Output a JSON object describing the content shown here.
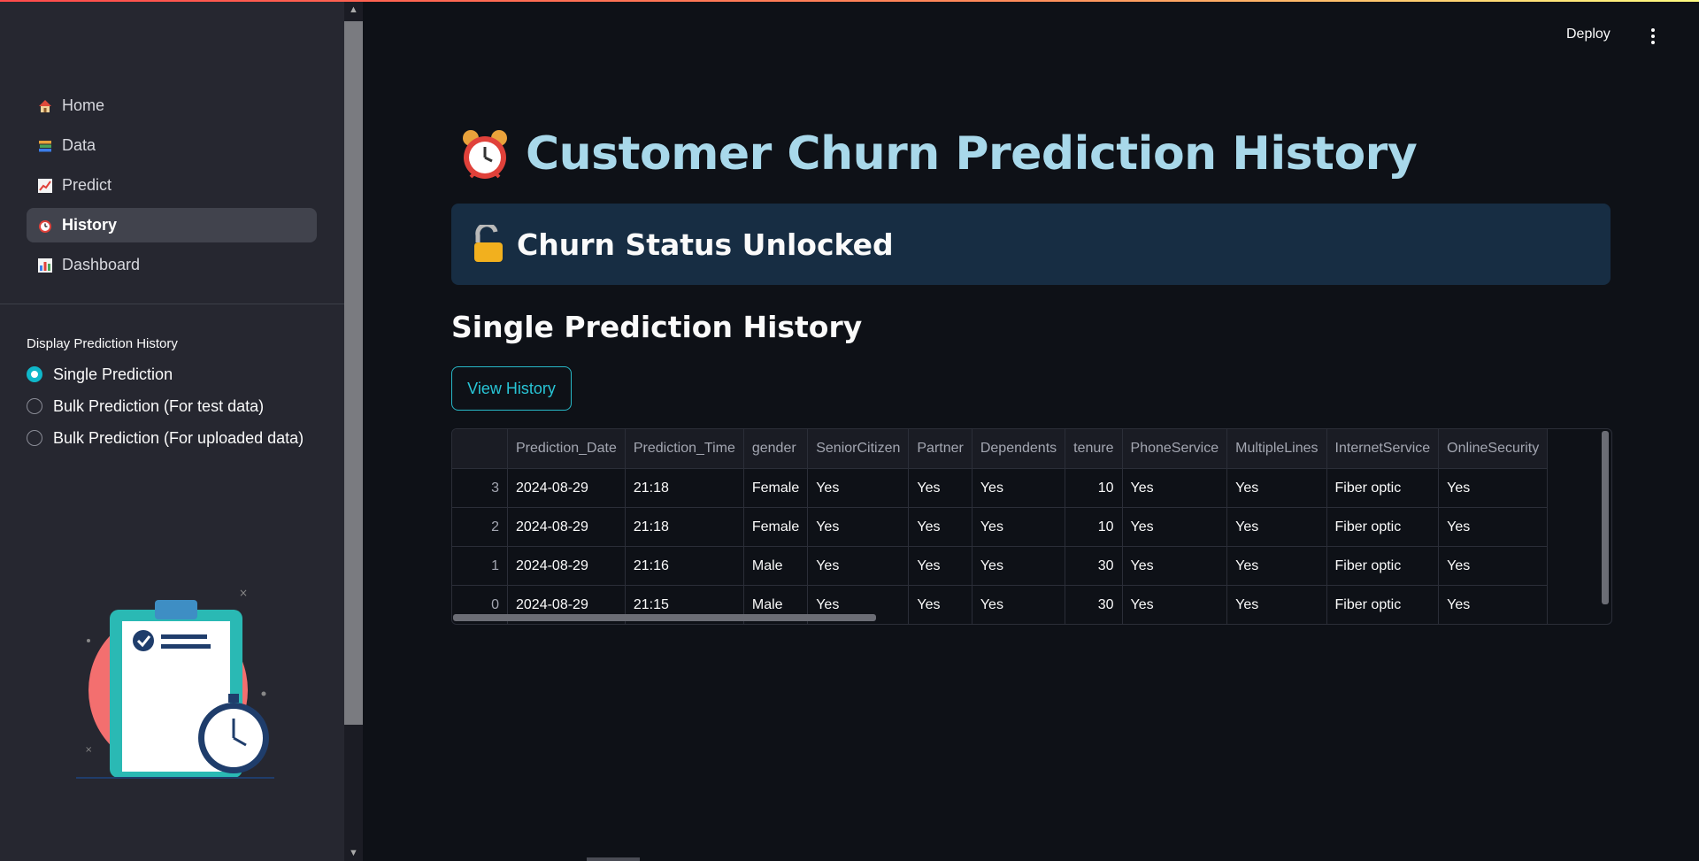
{
  "header": {
    "deploy_label": "Deploy"
  },
  "sidebar": {
    "nav": [
      {
        "label": "Home",
        "icon": "house-icon"
      },
      {
        "label": "Data",
        "icon": "books-icon"
      },
      {
        "label": "Predict",
        "icon": "chart-increasing-icon"
      },
      {
        "label": "History",
        "icon": "alarm-clock-icon",
        "active": true
      },
      {
        "label": "Dashboard",
        "icon": "bar-chart-icon"
      }
    ],
    "radio_title": "Display Prediction History",
    "radio_options": [
      {
        "label": "Single Prediction",
        "selected": true
      },
      {
        "label": "Bulk Prediction (For test data)",
        "selected": false
      },
      {
        "label": "Bulk Prediction (For uploaded data)",
        "selected": false
      }
    ]
  },
  "main": {
    "title": "Customer Churn Prediction History",
    "title_icon": "alarm-clock-icon",
    "banner_text": "Churn Status Unlocked",
    "banner_icon": "unlocked-padlock-icon",
    "subheader": "Single Prediction History",
    "view_button": "View History"
  },
  "table": {
    "columns": [
      "",
      "Prediction_Date",
      "Prediction_Time",
      "gender",
      "SeniorCitizen",
      "Partner",
      "Dependents",
      "tenure",
      "PhoneService",
      "MultipleLines",
      "InternetService",
      "OnlineSecurity"
    ],
    "rows": [
      [
        "3",
        "2024-08-29",
        "21:18",
        "Female",
        "Yes",
        "Yes",
        "Yes",
        "10",
        "Yes",
        "Yes",
        "Fiber optic",
        "Yes"
      ],
      [
        "2",
        "2024-08-29",
        "21:18",
        "Female",
        "Yes",
        "Yes",
        "Yes",
        "10",
        "Yes",
        "Yes",
        "Fiber optic",
        "Yes"
      ],
      [
        "1",
        "2024-08-29",
        "21:16",
        "Male",
        "Yes",
        "Yes",
        "Yes",
        "30",
        "Yes",
        "Yes",
        "Fiber optic",
        "Yes"
      ],
      [
        "0",
        "2024-08-29",
        "21:15",
        "Male",
        "Yes",
        "Yes",
        "Yes",
        "30",
        "Yes",
        "Yes",
        "Fiber optic",
        "Yes"
      ]
    ]
  },
  "colors": {
    "accent": "#0fb7c9",
    "title": "#a8d8ea",
    "banner_bg": "#172d43",
    "sidebar_bg": "#262730",
    "main_bg": "#0e1117"
  }
}
